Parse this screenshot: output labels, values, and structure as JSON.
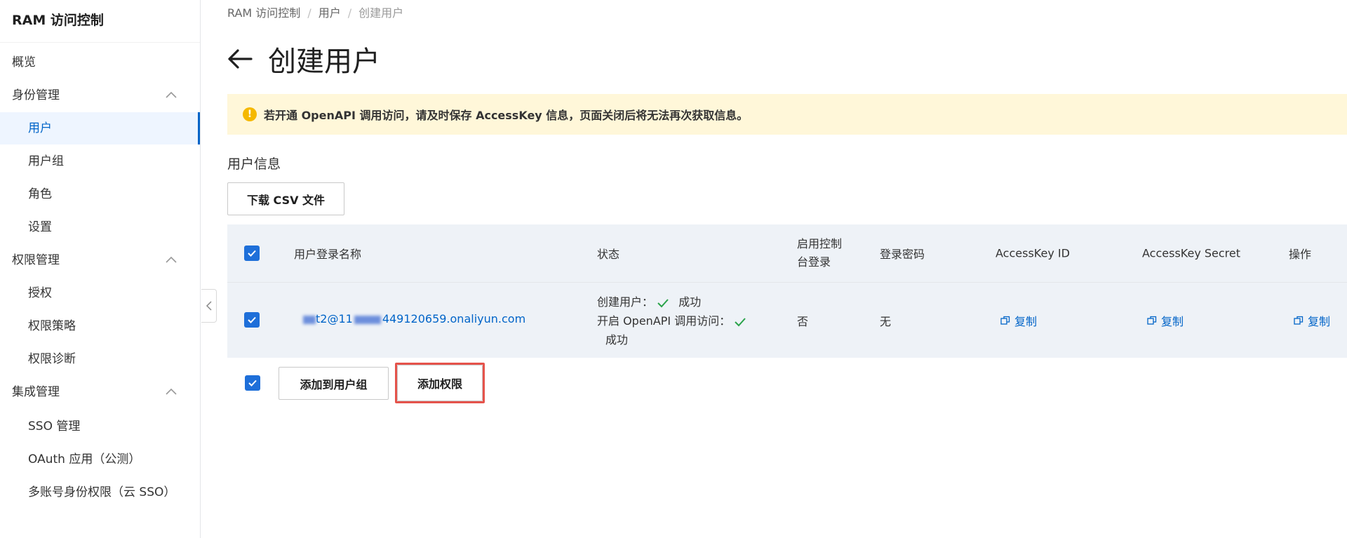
{
  "sidebar": {
    "title": "RAM 访问控制",
    "items": [
      {
        "label": "概览"
      },
      {
        "label": "身份管理"
      },
      {
        "label": "用户"
      },
      {
        "label": "用户组"
      },
      {
        "label": "角色"
      },
      {
        "label": "设置"
      },
      {
        "label": "权限管理"
      },
      {
        "label": "授权"
      },
      {
        "label": "权限策略"
      },
      {
        "label": "权限诊断"
      },
      {
        "label": "集成管理"
      },
      {
        "label": "SSO 管理"
      },
      {
        "label": "OAuth 应用（公测）"
      },
      {
        "label": "多账号身份权限（云 SSO）"
      }
    ]
  },
  "breadcrumb": [
    "RAM 访问控制",
    "用户",
    "创建用户"
  ],
  "page": {
    "title": "创建用户",
    "notice": "若开通 OpenAPI 调用访问，请及时保存 AccessKey 信息，页面关闭后将无法再次获取信息。",
    "section_title": "用户信息",
    "download_button": "下载 CSV 文件"
  },
  "table": {
    "headers": {
      "name": "用户登录名称",
      "status": "状态",
      "console_login_1": "启用控制",
      "console_login_2": "台登录",
      "password": "登录密码",
      "ak_id": "AccessKey ID",
      "ak_secret": "AccessKey Secret",
      "action": "操作"
    },
    "row": {
      "login_name_a": "t2@11",
      "login_name_b": "449120659.onaliyun.com",
      "status_create_label": "创建用户：",
      "status_create_result": "成功",
      "status_api_label": "开启 OpenAPI 调用访问：",
      "status_api_result": "成功",
      "console_login": "否",
      "password": "无",
      "ak_id_copy": "复制",
      "ak_secret_copy": "复制",
      "action_copy": "复制"
    }
  },
  "actions": {
    "add_to_group": "添加到用户组",
    "add_permission": "添加权限"
  },
  "colors": {
    "accent": "#0064c8",
    "checkbox": "#1e6fd9",
    "notice_bg": "#fff7d9",
    "success": "#2aa34a",
    "highlight": "#e5534b"
  }
}
